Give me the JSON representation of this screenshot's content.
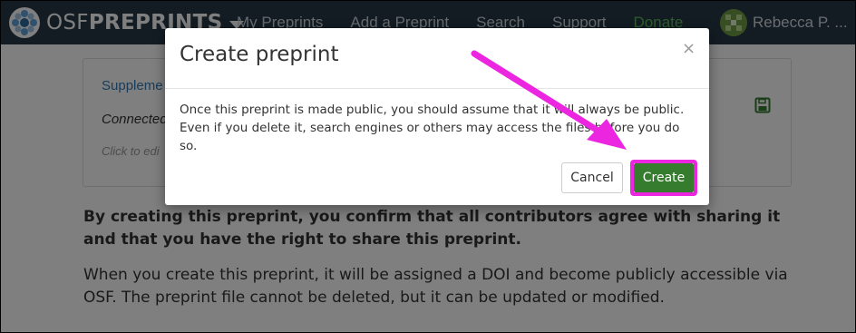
{
  "navbar": {
    "brand_light": "OSF",
    "brand_bold": "PREPRINTS",
    "links": [
      "My Preprints",
      "Add a Preprint",
      "Search",
      "Support",
      "Donate"
    ],
    "user_name": "Rebecca P. ..."
  },
  "panel": {
    "link_text": "Suppleme",
    "connected_text": "Connected",
    "edit_text": "Click to edi"
  },
  "page_text": {
    "confirm": "By creating this preprint, you confirm that all contributors agree with sharing it and that you have the right to share this preprint.",
    "doi": "When you create this preprint, it will be assigned a DOI and become publicly accessible via OSF. The preprint file cannot be deleted, but it can be updated or modified."
  },
  "modal": {
    "title": "Create preprint",
    "close": "×",
    "body": "Once this preprint is made public, you should assume that it will always be public. Even if you delete it, search engines or others may access the files before you do so.",
    "cancel_label": "Cancel",
    "create_label": "Create"
  },
  "colors": {
    "navbar": "#263947",
    "create_button": "#357c2f",
    "highlight": "#ec25e0",
    "donate": "#5cb85c"
  },
  "icons": [
    "osf-logo-icon",
    "caret-down-icon",
    "avatar",
    "floppy-disk-icon",
    "close-icon"
  ]
}
